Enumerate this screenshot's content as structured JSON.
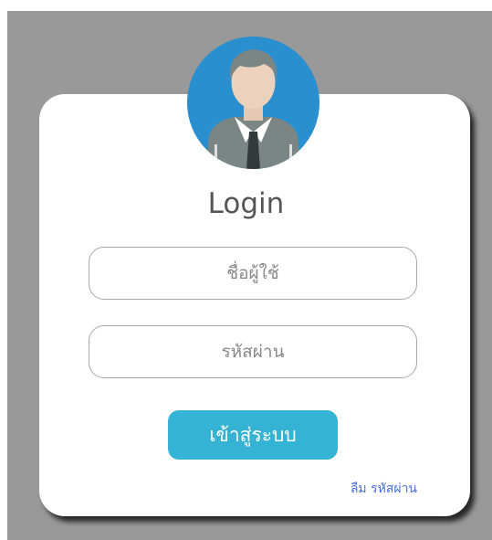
{
  "login": {
    "title": "Login",
    "username_placeholder": "ชื่อผู้ใช้",
    "username_value": "",
    "password_placeholder": "รหัสผ่าน",
    "password_value": "",
    "submit_label": "เข้าสู่ระบบ",
    "forgot_label": "ลืม รหัสผ่าน"
  },
  "colors": {
    "backdrop": "#999999",
    "card": "#ffffff",
    "avatar_bg": "#2a8fcf",
    "button": "#35b3d5",
    "link": "#4a6fd6"
  },
  "icons": {
    "avatar": "user-avatar-icon"
  }
}
